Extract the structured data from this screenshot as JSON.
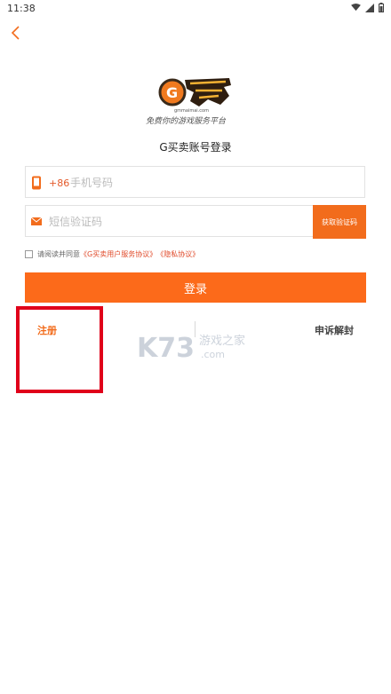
{
  "status": {
    "time": "11:38"
  },
  "logo": {
    "caption": "免费你的游戏服务平台"
  },
  "page_title": "G买卖账号登录",
  "phone": {
    "prefix": "+86",
    "placeholder": "手机号码"
  },
  "code": {
    "placeholder": "短信验证码",
    "button_label": "获取验证码"
  },
  "agreement": {
    "text": "请阅读并同意",
    "terms": "《G买卖用户服务协议》",
    "privacy": "《隐私协议》"
  },
  "login_label": "登录",
  "register_label": "注册",
  "appeal_label": "申诉解封",
  "watermark": {
    "brand": "K73",
    "sub": "游戏之家",
    "domain": ".com"
  },
  "colors": {
    "accent": "#fc6a1a",
    "highlight": "#e0001a"
  }
}
